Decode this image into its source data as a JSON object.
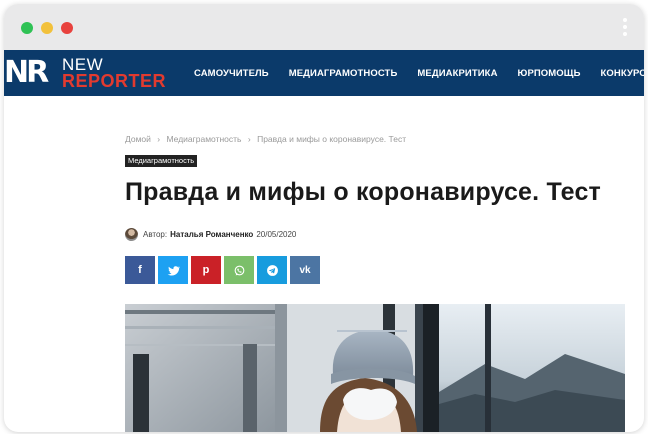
{
  "window": {
    "traffic_lights": {
      "green": "#2fc255",
      "yellow": "#f2c13b",
      "red": "#e8423e"
    },
    "menu_icon": "kebab-menu-icon"
  },
  "site": {
    "logo_mark": "NR",
    "logo_new": "NEW",
    "logo_reporter": "REPORTER",
    "nav_color": "#0b3a6a",
    "nav_items": [
      "САМОУЧИТЕЛЬ",
      "МЕДИАГРАМОТНОСТЬ",
      "МЕДИАКРИТИКА",
      "ЮРПОМОЩЬ",
      "КОНКУРС"
    ]
  },
  "article": {
    "breadcrumb": [
      "Домой",
      "›",
      "Медиаграмотность",
      "›",
      "Правда и мифы о коронавирусе. Тест"
    ],
    "category": "Медиаграмотность",
    "title": "Правда и мифы о коронавирусе. Тест",
    "author_prefix": "Автор:",
    "author": "Наталья Романченко",
    "date": "20/05/2020",
    "share_buttons": [
      {
        "name": "facebook",
        "glyph": "f",
        "color": "#3b5998"
      },
      {
        "name": "twitter",
        "glyph": "twitter-icon",
        "color": "#1da1f2"
      },
      {
        "name": "pinterest",
        "glyph": "p",
        "color": "#ca2127"
      },
      {
        "name": "whatsapp",
        "glyph": "whatsapp-icon",
        "color": "#7bbf6a"
      },
      {
        "name": "telegram",
        "glyph": "telegram-icon",
        "color": "#179cde"
      },
      {
        "name": "vk",
        "glyph": "vk",
        "color": "#4c75a3"
      }
    ],
    "hero_image": "woman-in-mask-on-train-image"
  }
}
